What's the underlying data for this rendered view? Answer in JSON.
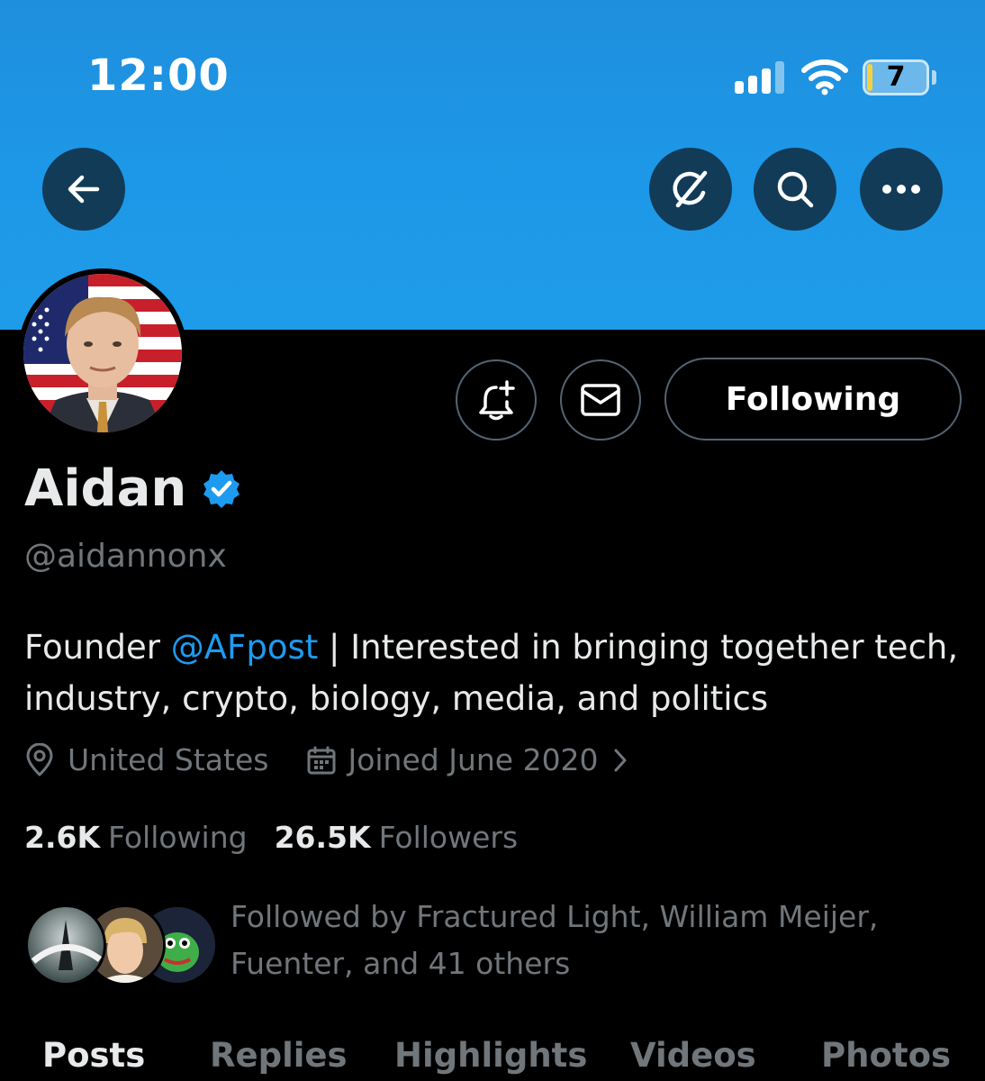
{
  "status_bar": {
    "time": "12:00",
    "battery_level": "7",
    "signal_bars_filled": 3,
    "signal_bars_total": 4
  },
  "nav": {
    "back_icon": "arrow-left-icon",
    "grok_icon": "grok-icon",
    "search_icon": "search-icon",
    "more_icon": "more-horizontal-icon"
  },
  "profile": {
    "name": "Aidan",
    "handle": "@aidannonx",
    "verified": true,
    "bio_prefix": "Founder ",
    "bio_mention": "@AFpost",
    "bio_suffix": " | Interested in bringing together tech, industry, crypto, biology, media, and politics",
    "location": "United States",
    "joined": "Joined June 2020",
    "following_count": "2.6K",
    "following_label": "Following",
    "followers_count": "26.5K",
    "followers_label": "Followers",
    "followed_by": "Followed by Fractured Light, William Meijer, Fuenter, and 41 others",
    "follow_button_label": "Following"
  },
  "tabs": [
    {
      "label": "Posts",
      "active": true
    },
    {
      "label": "Replies",
      "active": false
    },
    {
      "label": "Highlights",
      "active": false
    },
    {
      "label": "Videos",
      "active": false
    },
    {
      "label": "Photos",
      "active": false
    }
  ],
  "colors": {
    "banner": "#1d98e8",
    "accent": "#1d9bf0",
    "muted": "#71767b",
    "text": "#e7e9ea",
    "background": "#000000"
  }
}
